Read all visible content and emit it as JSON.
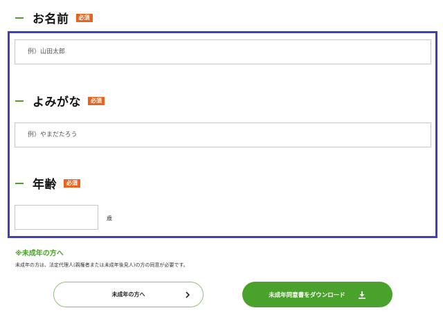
{
  "fields": {
    "name": {
      "label": "お名前",
      "required": "必須",
      "placeholder": "例）山田太郎"
    },
    "kana": {
      "label": "よみがな",
      "required": "必須",
      "placeholder": "例）やまだたろう"
    },
    "age": {
      "label": "年齢",
      "required": "必須",
      "unit": "歳"
    }
  },
  "minor_note": {
    "title": "※未成年の方へ",
    "text": "未成年の方は、法定代理人(親権者または未成年後見人)の方の同意が必要です。"
  },
  "buttons": {
    "minor": {
      "label": "未成年の方へ",
      "icon": "chevron-right-icon"
    },
    "download": {
      "label": "未成年同意書をダウンロード",
      "icon": "download-icon"
    }
  },
  "colors": {
    "accent_green": "#4aa12b",
    "required_badge": "#e8641a",
    "highlight_border": "#3c3fbf"
  }
}
